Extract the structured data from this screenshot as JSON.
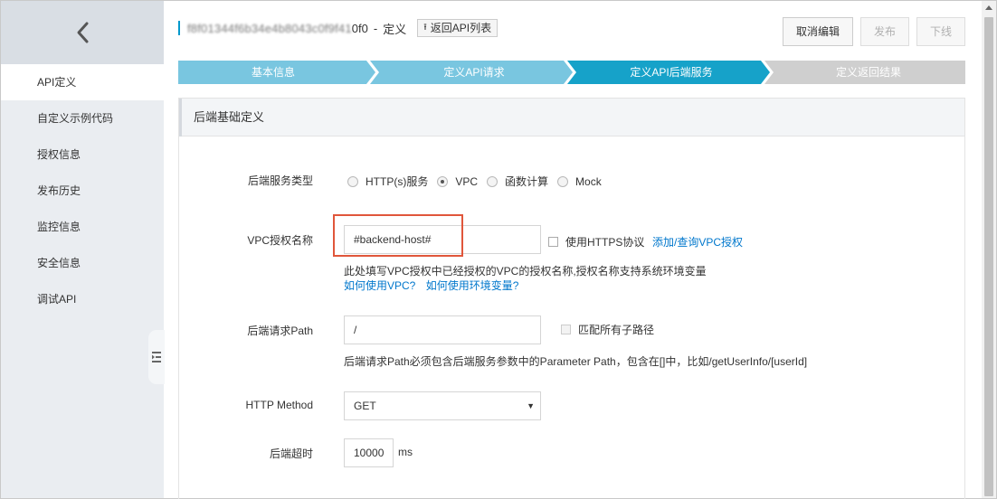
{
  "sidebar": {
    "back_icon": "chevron-left-icon",
    "items": [
      {
        "label": "API定义",
        "active": true
      },
      {
        "label": "自定义示例代码"
      },
      {
        "label": "授权信息"
      },
      {
        "label": "发布历史"
      },
      {
        "label": "监控信息"
      },
      {
        "label": "安全信息"
      },
      {
        "label": "调试API"
      }
    ],
    "collapse_icon": "collapse-sidebar-icon"
  },
  "header": {
    "api_id_blurred": "f8f01344f6b34e4b8043c0f9f41",
    "api_id_suffix": "0f0",
    "separator": "-",
    "page_label": "定义",
    "back_to_list": "返回API列表",
    "back_to_list_icon": "return-icon",
    "actions": {
      "cancel_edit": "取消编辑",
      "publish": "发布",
      "offline": "下线"
    }
  },
  "steps": [
    {
      "label": "基本信息",
      "state": "done"
    },
    {
      "label": "定义API请求",
      "state": "done"
    },
    {
      "label": "定义API后端服务",
      "state": "current"
    },
    {
      "label": "定义返回结果",
      "state": "todo"
    }
  ],
  "colors": {
    "step_done": "#79c6e0",
    "step_current": "#16a2c9",
    "step_todo": "#cfcfcf",
    "link": "#0077cc",
    "highlight": "#e0563b"
  },
  "panel": {
    "title": "后端基础定义",
    "backend_type": {
      "label": "后端服务类型",
      "options": [
        "HTTP(s)服务",
        "VPC",
        "函数计算",
        "Mock"
      ],
      "selected": "VPC"
    },
    "vpc_name": {
      "label": "VPC授权名称",
      "value": "#backend-host#",
      "https_checkbox": "使用HTTPS协议",
      "add_link": "添加/查询VPC授权",
      "help": "此处填写VPC授权中已经授权的VPC的授权名称,授权名称支持系统环境变量",
      "help_link_vpc": "如何使用VPC?",
      "help_link_env": "如何使用环境变量?"
    },
    "path": {
      "label": "后端请求Path",
      "value": "/",
      "match_all_checkbox": "匹配所有子路径",
      "help": "后端请求Path必须包含后端服务参数中的Parameter Path，包含在[]中，比如/getUserInfo/[userId]"
    },
    "http_method": {
      "label": "HTTP Method",
      "value": "GET"
    },
    "timeout": {
      "label": "后端超时",
      "value": "10000",
      "unit": "ms"
    }
  }
}
